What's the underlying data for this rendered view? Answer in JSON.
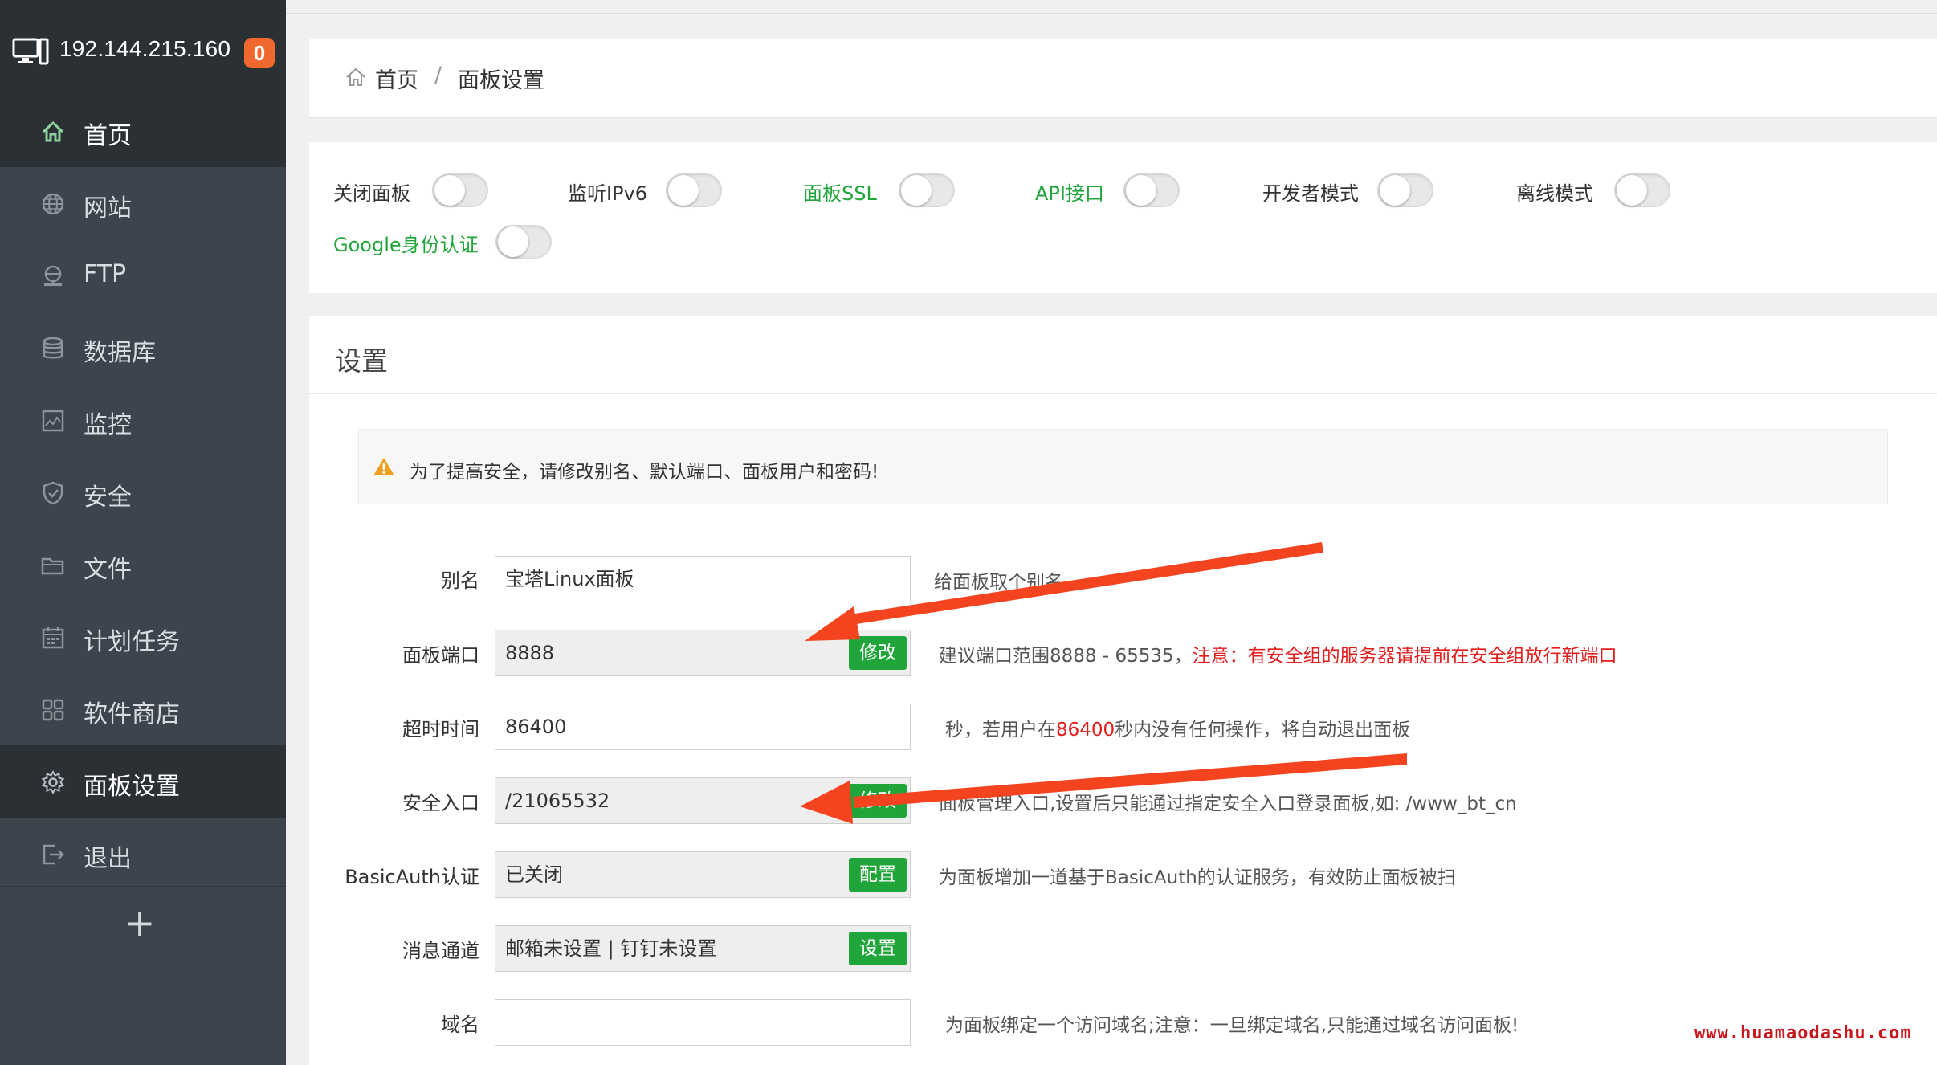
{
  "sidebar": {
    "ip": "192.144.215.160",
    "badge": "0",
    "items": [
      {
        "label": "首页",
        "icon": "home-icon"
      },
      {
        "label": "网站",
        "icon": "globe-icon"
      },
      {
        "label": "FTP",
        "icon": "ftp-icon"
      },
      {
        "label": "数据库",
        "icon": "database-icon"
      },
      {
        "label": "监控",
        "icon": "monitor-chart-icon"
      },
      {
        "label": "安全",
        "icon": "shield-icon"
      },
      {
        "label": "文件",
        "icon": "folder-icon"
      },
      {
        "label": "计划任务",
        "icon": "calendar-icon"
      },
      {
        "label": "软件商店",
        "icon": "apps-grid-icon"
      },
      {
        "label": "面板设置",
        "icon": "gear-icon"
      },
      {
        "label": "退出",
        "icon": "logout-icon"
      }
    ],
    "plus": "+"
  },
  "breadcrumb": {
    "home": "首页",
    "separator": "/",
    "current": "面板设置"
  },
  "toggles": [
    {
      "label": "关闭面板",
      "on": false
    },
    {
      "label": "监听IPv6",
      "on": false
    },
    {
      "label": "面板SSL",
      "on": false
    },
    {
      "label": "API接口",
      "on": false
    },
    {
      "label": "开发者模式",
      "on": false
    },
    {
      "label": "离线模式",
      "on": false
    },
    {
      "label": "Google身份认证",
      "on": false
    }
  ],
  "settings": {
    "title": "设置",
    "alert": "为了提高安全，请修改别名、默认端口、面板用户和密码!",
    "rows": {
      "alias": {
        "label": "别名",
        "value": "宝塔Linux面板",
        "help": "给面板取个别名"
      },
      "port": {
        "label": "面板端口",
        "value": "8888",
        "button": "修改",
        "help": "建议端口范围8888 - 65535，",
        "help_warn": "注意：有安全组的服务器请提前在安全组放行新端口"
      },
      "timeout": {
        "label": "超时时间",
        "value": "86400",
        "help_a": "秒，若用户在",
        "help_num": "86400",
        "help_b": "秒内没有任何操作，将自动退出面板"
      },
      "entry": {
        "label": "安全入口",
        "value": "/21065532",
        "button": "修改",
        "help": "面板管理入口,设置后只能通过指定安全入口登录面板,如: /www_bt_cn"
      },
      "basicauth": {
        "label": "BasicAuth认证",
        "value": "已关闭",
        "button": "配置",
        "help": "为面板增加一道基于BasicAuth的认证服务，有效防止面板被扫"
      },
      "message": {
        "label": "消息通道",
        "value": "邮箱未设置 | 钉钉未设置",
        "button": "设置"
      },
      "domain": {
        "label": "域名",
        "value": "",
        "help": "为面板绑定一个访问域名;注意：一旦绑定域名,只能通过域名访问面板!"
      }
    }
  },
  "watermark": "www.huamaodashu.com",
  "colors": {
    "sidebar": "#3c444d",
    "sidebar_active": "#2b3035",
    "green": "#20a53a",
    "badge": "#f0682e",
    "arrow": "#f4431f"
  }
}
